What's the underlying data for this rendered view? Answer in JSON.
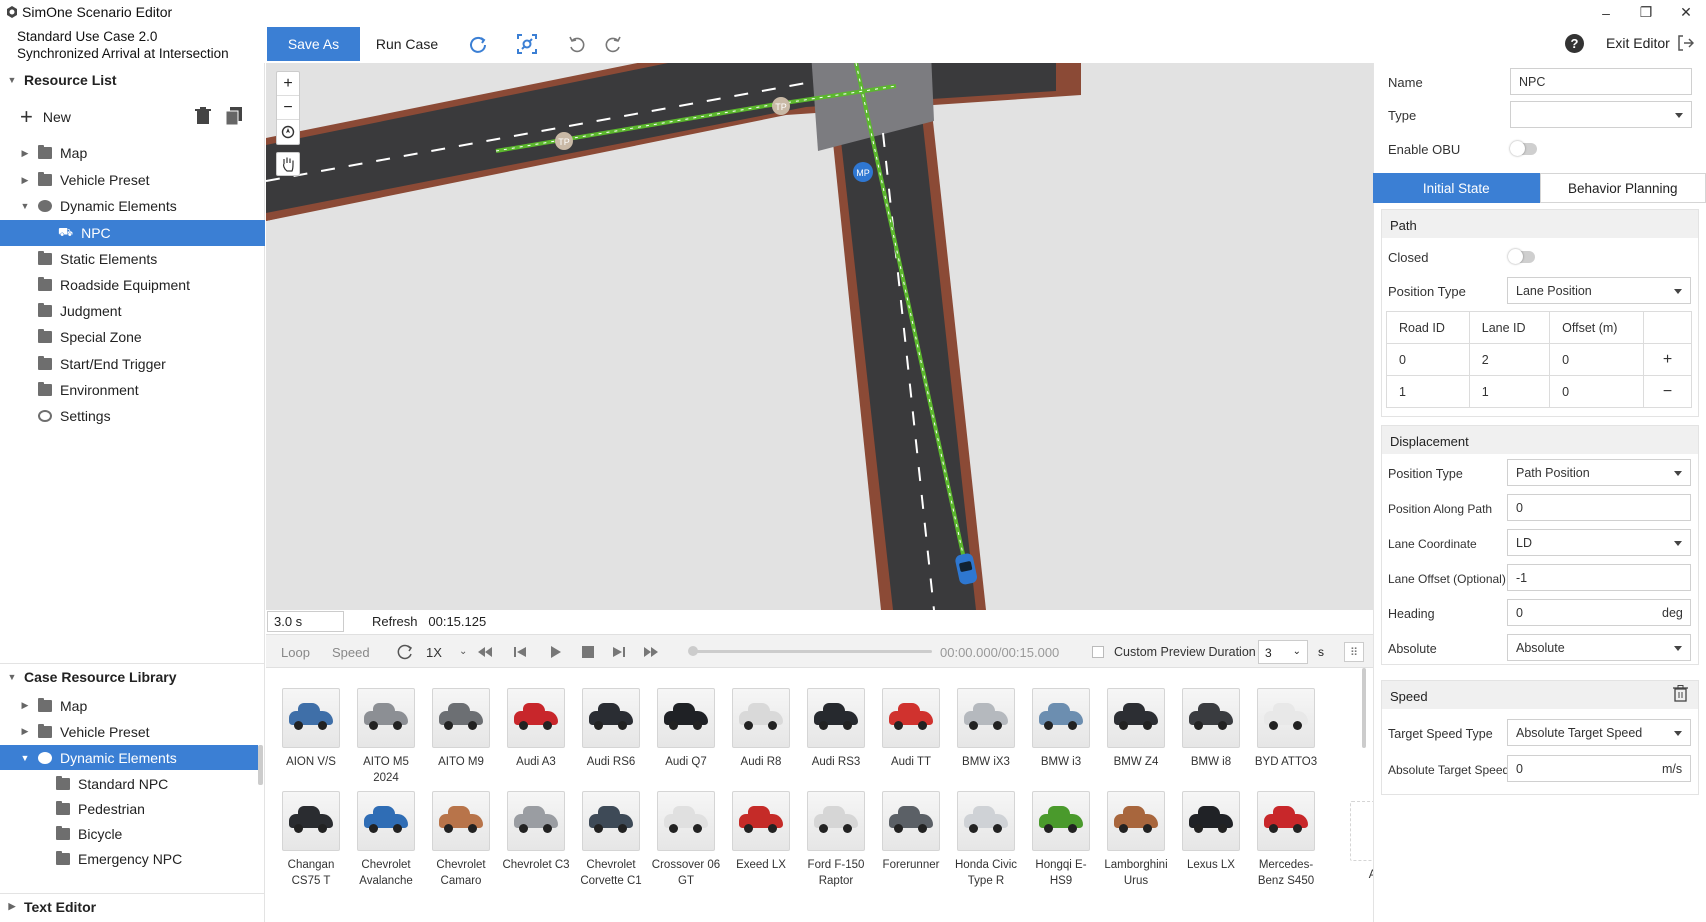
{
  "window": {
    "title": "SimOne Scenario Editor",
    "min": "–",
    "restore": "❐",
    "close": "✕"
  },
  "case": {
    "line1": "Standard Use Case 2.0",
    "line2": "Synchronized Arrival at Intersection"
  },
  "toolbar": {
    "save_as": "Save As",
    "run_case": "Run Case",
    "exit_editor": "Exit Editor",
    "help": "?"
  },
  "resource_list": {
    "title": "Resource List",
    "new_label": "New",
    "items": [
      {
        "label": "Map",
        "icon": "map-icon"
      },
      {
        "label": "Vehicle Preset",
        "icon": "folder-icon"
      },
      {
        "label": "Dynamic Elements",
        "icon": "gear-icon"
      },
      {
        "label": "NPC",
        "icon": "npc-icon"
      },
      {
        "label": "Static Elements",
        "icon": "folder-icon"
      },
      {
        "label": "Roadside Equipment",
        "icon": "folder-icon"
      },
      {
        "label": "Judgment",
        "icon": "folder-icon"
      },
      {
        "label": "Special Zone",
        "icon": "folder-icon"
      },
      {
        "label": "Start/End Trigger",
        "icon": "folder-icon"
      },
      {
        "label": "Environment",
        "icon": "chart-icon"
      },
      {
        "label": "Settings",
        "icon": "gear-icon"
      }
    ]
  },
  "case_library": {
    "title": "Case Resource Library",
    "items": [
      {
        "label": "Map"
      },
      {
        "label": "Vehicle Preset"
      },
      {
        "label": "Dynamic Elements"
      },
      {
        "label": "Standard NPC"
      },
      {
        "label": "Pedestrian"
      },
      {
        "label": "Bicycle"
      },
      {
        "label": "Emergency NPC"
      }
    ]
  },
  "text_editor": "Text Editor",
  "map_view": {
    "markers": {
      "tp1": "TP",
      "tp2": "TP",
      "mp": "MP"
    },
    "zoom_in": "+",
    "zoom_out": "−"
  },
  "status": {
    "time_value": "3.0 s",
    "refresh": "Refresh",
    "refresh_time": "00:15.125"
  },
  "playback": {
    "loop": "Loop",
    "speed": "Speed",
    "rate": "1X",
    "time": "00:00.000/00:15.000",
    "custom_preview": "Custom Preview Duration",
    "duration": "3",
    "unit": "s"
  },
  "vehicles_row1": [
    {
      "name": "AION V/S",
      "color": "#3f6fa8"
    },
    {
      "name": "AITO M5 2024",
      "color": "#8c8f94"
    },
    {
      "name": "AITO M9",
      "color": "#6c6f73"
    },
    {
      "name": "Audi A3",
      "color": "#c8262b"
    },
    {
      "name": "Audi RS6",
      "color": "#2a2d33"
    },
    {
      "name": "Audi Q7",
      "color": "#1f2125"
    },
    {
      "name": "Audi R8",
      "color": "#d9d9d9"
    },
    {
      "name": "Audi RS3",
      "color": "#26292e"
    },
    {
      "name": "Audi TT",
      "color": "#d0322e"
    },
    {
      "name": "BMW iX3",
      "color": "#b5b9be"
    },
    {
      "name": "BMW i3",
      "color": "#6c8eb0"
    },
    {
      "name": "BMW Z4",
      "color": "#2c2e33"
    },
    {
      "name": "BMW i8",
      "color": "#3a3c40"
    },
    {
      "name": "BYD ATTO3",
      "color": "#e8e8e8"
    }
  ],
  "vehicles_row2": [
    {
      "name": "Changan CS75 T",
      "color": "#2a2c30"
    },
    {
      "name": "Chevrolet Avalanche",
      "color": "#2f6db5"
    },
    {
      "name": "Chevrolet Camaro",
      "color": "#b8744a"
    },
    {
      "name": "Chevrolet C3",
      "color": "#9a9da2"
    },
    {
      "name": "Chevrolet Corvette C1",
      "color": "#3e4a57"
    },
    {
      "name": "Crossover 06 GT",
      "color": "#e0e0e0"
    },
    {
      "name": "Exeed LX",
      "color": "#c52b28"
    },
    {
      "name": "Ford F-150 Raptor",
      "color": "#d6d6d6"
    },
    {
      "name": "Forerunner",
      "color": "#5b6066"
    },
    {
      "name": "Honda Civic Type R",
      "color": "#cfd2d6"
    },
    {
      "name": "Hongqi E-HS9",
      "color": "#4a9a2c"
    },
    {
      "name": "Lamborghini Urus",
      "color": "#a8663d"
    },
    {
      "name": "Lexus LX",
      "color": "#202226"
    },
    {
      "name": "Mercedes-Benz S450",
      "color": "#c8272a"
    }
  ],
  "add_label": "Add",
  "props": {
    "name_label": "Name",
    "name_value": "NPC",
    "type_label": "Type",
    "type_value": "",
    "obu_label": "Enable OBU",
    "tab_initial": "Initial State",
    "tab_behavior": "Behavior Planning",
    "path": {
      "title": "Path",
      "closed_label": "Closed",
      "position_type_label": "Position Type",
      "position_type_value": "Lane Position",
      "columns": [
        "Road ID",
        "Lane ID",
        "Offset (m)"
      ],
      "rows": [
        [
          "0",
          "2",
          "0"
        ],
        [
          "1",
          "1",
          "0"
        ]
      ],
      "add": "+",
      "remove": "−"
    },
    "displacement": {
      "title": "Displacement",
      "position_type_label": "Position Type",
      "position_type_value": "Path Position",
      "along_label": "Position Along Path",
      "along_value": "0",
      "lane_coord_label": "Lane Coordinate",
      "lane_coord_value": "LD",
      "lane_offset_label": "Lane Offset (Optional)",
      "lane_offset_value": "-1",
      "heading_label": "Heading",
      "heading_value": "0",
      "heading_unit": "deg",
      "absolute_label": "Absolute",
      "absolute_value": "Absolute"
    },
    "speed": {
      "title": "Speed",
      "type_label": "Target Speed Type",
      "type_value": "Absolute Target Speed",
      "abs_label": "Absolute Target Speed",
      "abs_value": "0",
      "abs_unit": "m/s"
    }
  },
  "colors": {
    "accent": "#3b7fd4",
    "road": "#3a3a3c",
    "curb": "#8b4a36",
    "path": "#5cb82e"
  }
}
